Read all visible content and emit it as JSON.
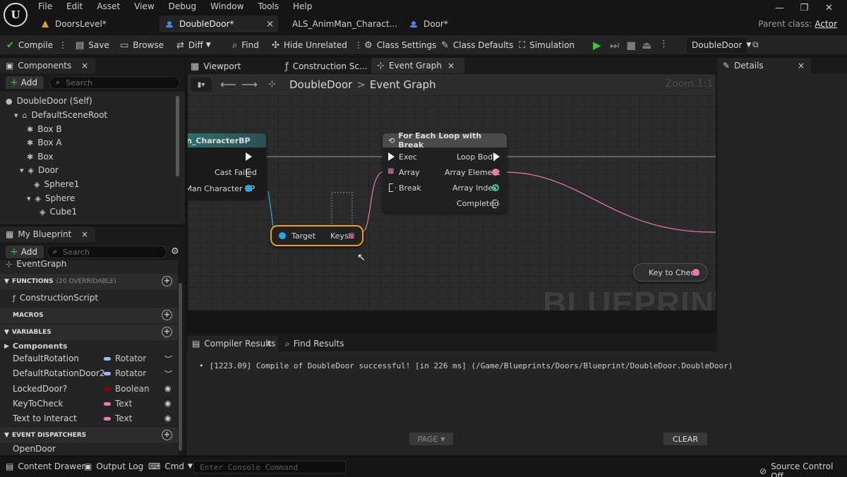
{
  "app": {
    "logo_text": "U"
  },
  "menu": [
    "File",
    "Edit",
    "Asset",
    "View",
    "Debug",
    "Window",
    "Tools",
    "Help"
  ],
  "doc_tabs": [
    {
      "label": "DoorsLevel*",
      "icon": "level-icon"
    },
    {
      "label": "DoubleDoor*",
      "icon": "blueprint-icon",
      "close": "×"
    },
    {
      "label": "ALS_AnimMan_Charact...",
      "icon": "blueprint-icon"
    },
    {
      "label": "Door*",
      "icon": "blueprint-icon"
    }
  ],
  "window_controls": [
    "—",
    "❐",
    "✕"
  ],
  "parent_class": {
    "label": "Parent class:",
    "value": "Actor"
  },
  "toolbar": {
    "compile": "Compile",
    "save": "Save",
    "browse": "Browse",
    "diff": "Diff",
    "find": "Find",
    "hide_unrelated": "Hide Unrelated",
    "class_settings": "Class Settings",
    "class_defaults": "Class Defaults",
    "simulation": "Simulation",
    "debug_object": "DoubleDoor"
  },
  "components_panel": {
    "title": "Components",
    "add": "Add",
    "search_placeholder": "Search",
    "tree": [
      {
        "label": "DoubleDoor (Self)"
      },
      {
        "label": "DefaultSceneRoot"
      },
      {
        "label": "Box B"
      },
      {
        "label": "Box A"
      },
      {
        "label": "Box"
      },
      {
        "label": "Door"
      },
      {
        "label": "Sphere1"
      },
      {
        "label": "Sphere"
      },
      {
        "label": "Cube1"
      }
    ]
  },
  "my_blueprint": {
    "title": "My Blueprint",
    "add": "Add",
    "search_placeholder": "Search",
    "event_graph": "EventGraph",
    "functions_label": "FUNCTIONS",
    "functions_note": "(20 OVERRIDABLE)",
    "functions": [
      "ConstructionScript"
    ],
    "macros_label": "MACROS",
    "variables_label": "VARIABLES",
    "components_label": "Components",
    "variables": [
      {
        "name": "DefaultRotation",
        "type": "Rotator",
        "color": "#a0b4ff"
      },
      {
        "name": "DefaultRotationDoor2",
        "type": "Rotator",
        "color": "#a0b4ff"
      },
      {
        "name": "LockedDoor?",
        "type": "Boolean",
        "color": "#8c0000"
      },
      {
        "name": "KeyToCheck",
        "type": "Text",
        "color": "#e87ab0"
      },
      {
        "name": "Text to Interact",
        "type": "Text",
        "color": "#e87ab0"
      }
    ],
    "dispatchers_label": "EVENT DISPATCHERS",
    "dispatchers": [
      "OpenDoor"
    ]
  },
  "editor_tabs": {
    "viewport": "Viewport",
    "construction": "Construction Sc...",
    "event_graph": "Event Graph"
  },
  "graph": {
    "breadcrumb_root": "DoubleDoor",
    "breadcrumb_sep": ">",
    "breadcrumb_leaf": "Event Graph",
    "zoom": "Zoom 1:1",
    "watermark": "BLUEPRINT",
    "cast_node": {
      "title": "n_CharacterBP",
      "cast_failed": "Cast Failed",
      "output": "n Man Character BP"
    },
    "keys_node": {
      "target": "Target",
      "keys": "Keys"
    },
    "foreach_node": {
      "title": "For Each Loop with Break",
      "exec": "Exec",
      "array": "Array",
      "break": "Break",
      "loop_body": "Loop Body",
      "array_element": "Array Element",
      "array_index": "Array Index",
      "completed": "Completed"
    },
    "var_node": {
      "label": "Key to Check"
    }
  },
  "details_panel": {
    "title": "Details"
  },
  "bottom": {
    "compiler_results": "Compiler Results",
    "find_results": "Find Results",
    "log_line": "[1223.09] Compile of DoubleDoor successful! [in 226 ms] (/Game/Blueprints/Doors/Blueprint/DoubleDoor.DoubleDoor)",
    "page": "PAGE",
    "clear": "CLEAR"
  },
  "status": {
    "content_drawer": "Content Drawer",
    "output_log": "Output Log",
    "cmd": "Cmd",
    "console_placeholder": "Enter Console Command",
    "source_control": "Source Control Off"
  },
  "colors": {
    "exec_pin": "#f0f0f0",
    "object_pin": "#27a9e0",
    "text_pin": "#e87ab0",
    "integer_pin": "#2fd19a",
    "selection": "#e8a020"
  }
}
